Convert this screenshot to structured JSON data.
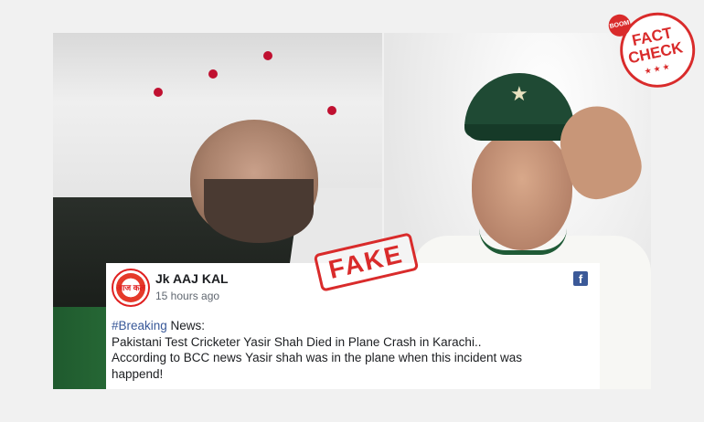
{
  "stamp": {
    "label": "FAKE",
    "color": "#d92b2b"
  },
  "badge": {
    "top": "BOOM",
    "line1": "FACT",
    "line2": "CHECK",
    "stars": "★★★"
  },
  "post": {
    "page_name": "Jk AAJ KAL",
    "avatar_text": "आज कल",
    "timestamp": "15 hours ago",
    "network_icon": "facebook-icon",
    "hashtag": "#Breaking",
    "hashtag_rest": " News:",
    "line2": "Pakistani Test Cricketer Yasir Shah Died in Plane Crash in Karachi..",
    "line3": "According to BCC news Yasir shah was in the plane when this incident was",
    "line4": "happend!"
  },
  "colors": {
    "accent": "#d92b2b",
    "facebook": "#3b5998",
    "link": "#385898"
  }
}
